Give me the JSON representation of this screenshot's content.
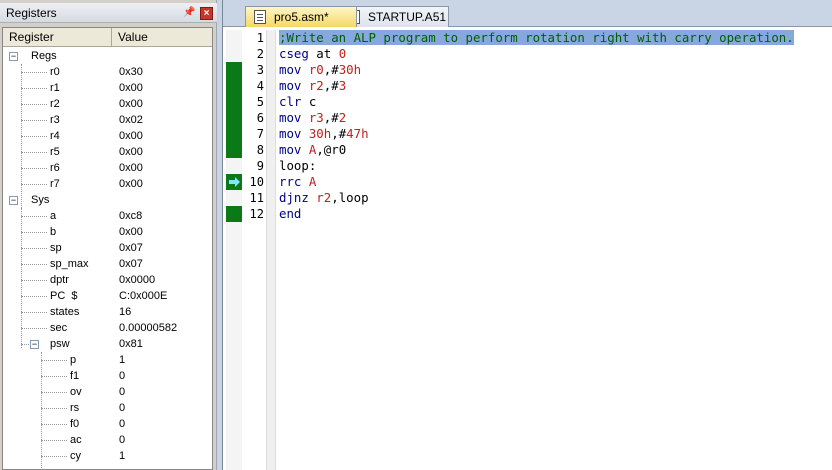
{
  "registers_panel": {
    "title": "Registers",
    "columns": {
      "register": "Register",
      "value": "Value"
    },
    "regs_label": "Regs",
    "regs": [
      {
        "name": "r0",
        "value": "0x30"
      },
      {
        "name": "r1",
        "value": "0x00"
      },
      {
        "name": "r2",
        "value": "0x00"
      },
      {
        "name": "r3",
        "value": "0x02"
      },
      {
        "name": "r4",
        "value": "0x00"
      },
      {
        "name": "r5",
        "value": "0x00"
      },
      {
        "name": "r6",
        "value": "0x00"
      },
      {
        "name": "r7",
        "value": "0x00"
      }
    ],
    "sys_label": "Sys",
    "sys": [
      {
        "name": "a",
        "value": "0xc8"
      },
      {
        "name": "b",
        "value": "0x00"
      },
      {
        "name": "sp",
        "value": "0x07"
      },
      {
        "name": "sp_max",
        "value": "0x07"
      },
      {
        "name": "dptr",
        "value": "0x0000"
      },
      {
        "name": "PC  $",
        "value": "C:0x000E"
      },
      {
        "name": "states",
        "value": "16"
      },
      {
        "name": "sec",
        "value": "0.00000582"
      },
      {
        "name": "psw",
        "value": "0x81"
      }
    ],
    "psw_bits": [
      {
        "name": "p",
        "value": "1"
      },
      {
        "name": "f1",
        "value": "0"
      },
      {
        "name": "ov",
        "value": "0"
      },
      {
        "name": "rs",
        "value": "0"
      },
      {
        "name": "f0",
        "value": "0"
      },
      {
        "name": "ac",
        "value": "0"
      },
      {
        "name": "cy",
        "value": "1"
      }
    ]
  },
  "editor": {
    "tabs": [
      {
        "label": "pro5.asm*",
        "active": true
      },
      {
        "label": "STARTUP.A51",
        "active": false
      }
    ],
    "lines": [
      {
        "num": "1",
        "text": ";Write an ALP program to perform rotation right with carry operation."
      },
      {
        "num": "2",
        "kw": "cseg",
        "rest": " at ",
        "val": "0"
      },
      {
        "num": "3",
        "kw": "mov",
        "reg": " r0",
        "rest": ",#",
        "val": "30h"
      },
      {
        "num": "4",
        "kw": "mov",
        "reg": " r2",
        "rest": ",#",
        "val": "3"
      },
      {
        "num": "5",
        "kw": "clr",
        "rest": " c"
      },
      {
        "num": "6",
        "kw": "mov",
        "reg": " r3",
        "rest": ",#",
        "val": "2"
      },
      {
        "num": "7",
        "kw": "mov",
        "reg": " 30h",
        "rest": ",#",
        "val": "47h"
      },
      {
        "num": "8",
        "kw": "mov",
        "reg": " A",
        "rest": ",@r0"
      },
      {
        "num": "9",
        "label": "loop:"
      },
      {
        "num": "10",
        "kw": "rrc",
        "reg": " A"
      },
      {
        "num": "11",
        "kw": "djnz",
        "reg": " r2",
        "rest": ",loop"
      },
      {
        "num": "12",
        "kw": "end"
      }
    ]
  },
  "colors": {
    "keyword": "#00008b",
    "register": "#c02020",
    "exec_marker": "#0a7a18",
    "selection": "#86a8dc",
    "active_tab": "#f5d866"
  }
}
